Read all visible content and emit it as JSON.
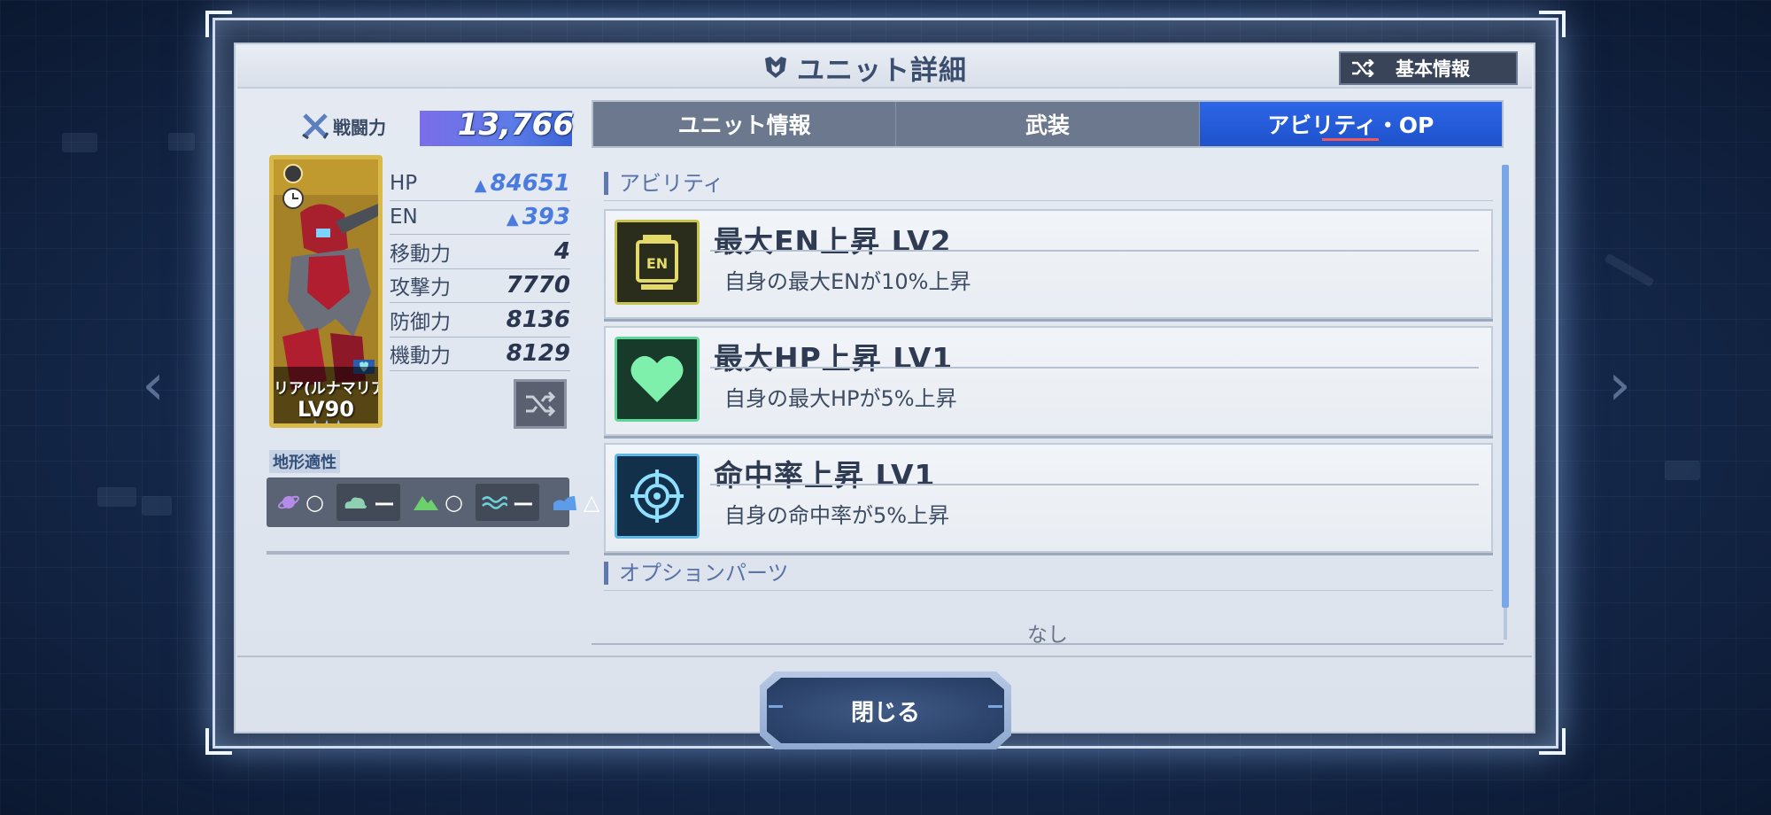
{
  "dialog": {
    "title": "ユニット詳細",
    "basic_info_button": "基本情報"
  },
  "unit": {
    "power_label": "戦闘力",
    "power_value": "13,766",
    "name": "リア(ルナマリア",
    "level": "LV90",
    "stars": 3,
    "stats": [
      {
        "label": "HP",
        "value": "84651",
        "boosted": true
      },
      {
        "label": "EN",
        "value": "393",
        "boosted": true
      },
      {
        "label": "移動力",
        "value": "4",
        "boosted": false
      },
      {
        "label": "攻撃力",
        "value": "7770",
        "boosted": false
      },
      {
        "label": "防御力",
        "value": "8136",
        "boosted": false
      },
      {
        "label": "機動力",
        "value": "8129",
        "boosted": false
      }
    ]
  },
  "terrain": {
    "label": "地形適性",
    "items": [
      {
        "icon": "space-icon",
        "grade": "○"
      },
      {
        "icon": "air-icon",
        "grade": "ー"
      },
      {
        "icon": "land-icon",
        "grade": "○"
      },
      {
        "icon": "sea-icon",
        "grade": "ー"
      },
      {
        "icon": "underwater-icon",
        "grade": "△"
      }
    ]
  },
  "tabs": [
    {
      "label": "ユニット情報",
      "active": false
    },
    {
      "label": "武装",
      "active": false
    },
    {
      "label": "アビリティ・OP",
      "active": true
    }
  ],
  "abilities_section": {
    "heading": "アビリティ",
    "items": [
      {
        "icon": "en-battery-icon",
        "title": "最大EN上昇 LV2",
        "desc": "自身の最大ENが10%上昇"
      },
      {
        "icon": "heart-icon",
        "title": "最大HP上昇 LV1",
        "desc": "自身の最大HPが5%上昇"
      },
      {
        "icon": "crosshair-icon",
        "title": "命中率上昇 LV1",
        "desc": "自身の命中率が5%上昇"
      }
    ]
  },
  "options_section": {
    "heading": "オプションパーツ",
    "empty_text": "なし"
  },
  "close_button": "閉じる",
  "colors": {
    "active_tab": "#2c66e6",
    "boost_value": "#4a7ce0",
    "card_gold": "#d8b94a"
  }
}
